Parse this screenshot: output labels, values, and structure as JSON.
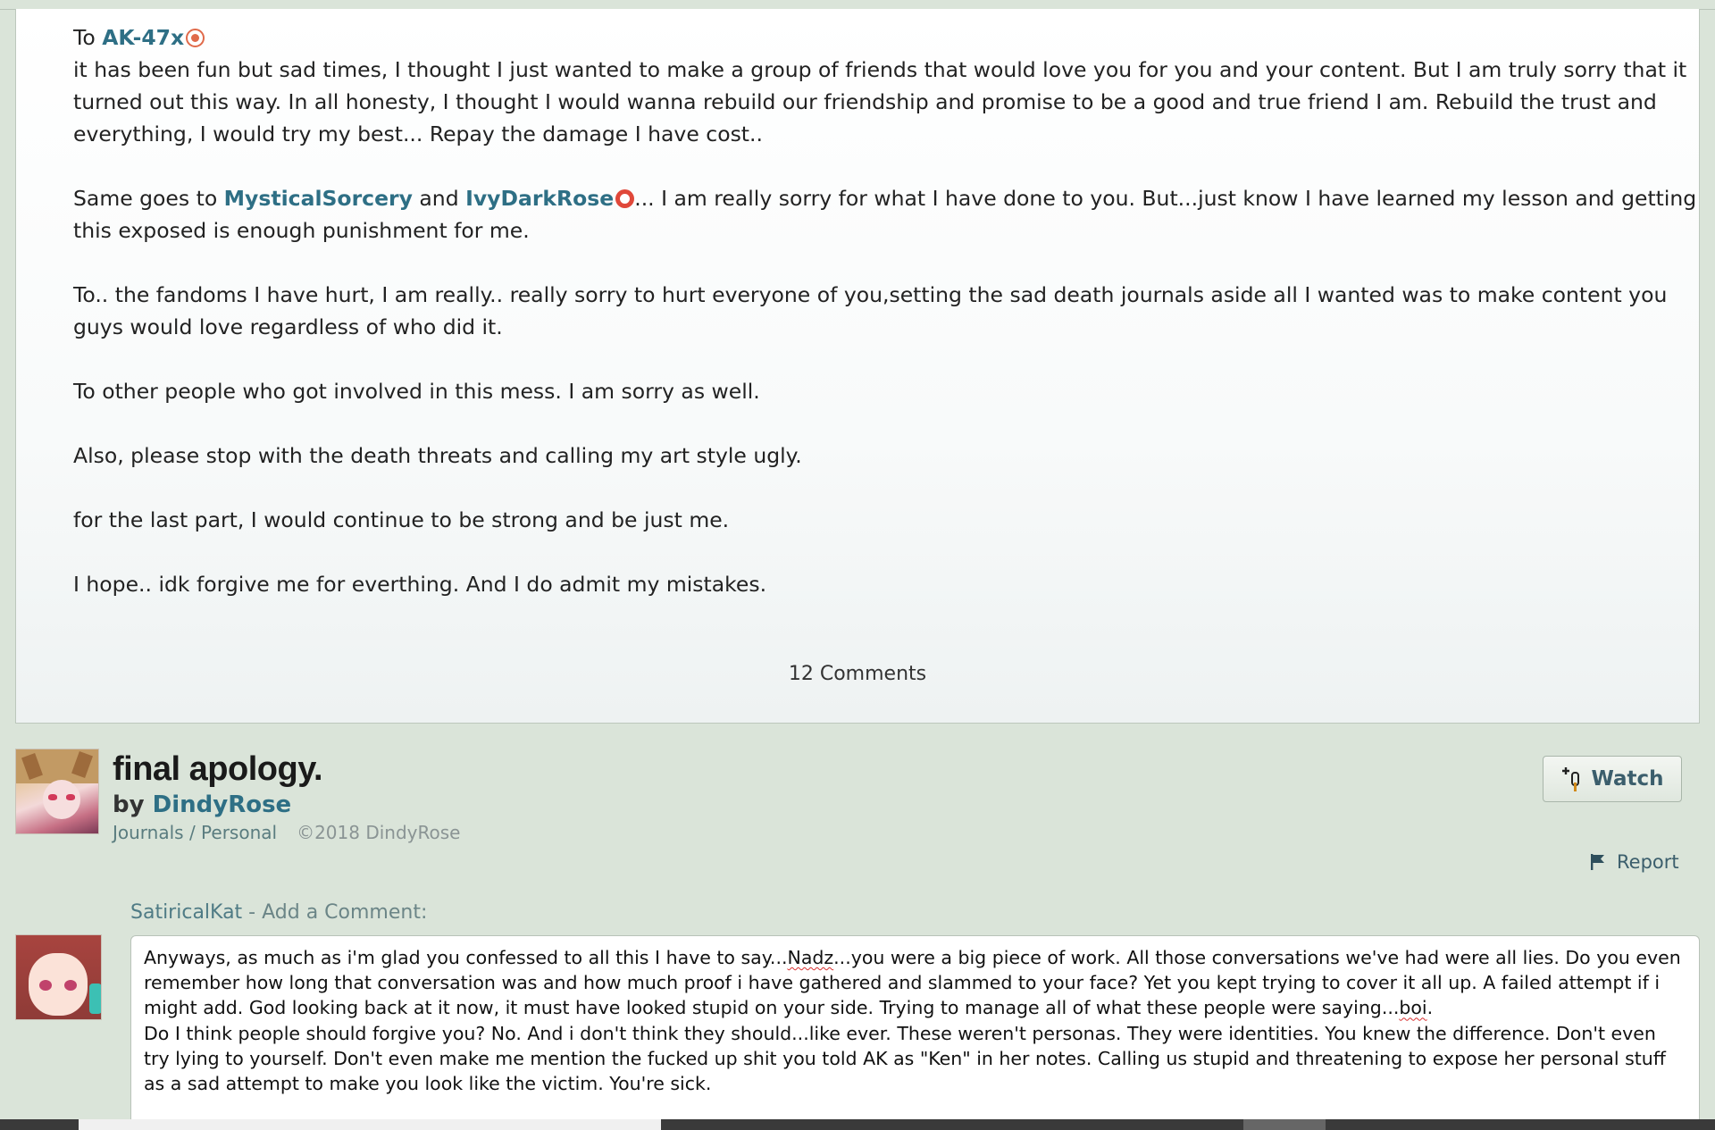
{
  "journal": {
    "to_prefix": "To ",
    "to_user": "AK-47x",
    "para1": "it has been fun but sad times, I thought I just wanted to make a group of friends that would love you for you and your content. But I am truly sorry that it turned out this way. In all honesty, I thought I would wanna rebuild our friendship and promise to be a good and true friend I am. Rebuild the trust and everything, I would try my best... Repay the damage I have cost..",
    "para2_prefix": "Same goes to ",
    "para2_user1": "MysticalSorcery",
    "para2_and": " and ",
    "para2_user2": "IvyDarkRose",
    "para2_rest": "... I am really sorry for what I have done to you. But...just know I have learned my lesson and getting this exposed is enough punishment for me.",
    "para3": "To.. the fandoms I have hurt, I am really.. really sorry to hurt everyone of you,setting the sad death journals aside all I wanted was to make content you guys would love regardless of who did it.",
    "para4": "To other people who got involved in this mess. I am sorry as well.",
    "para5": "Also, please stop with the death threats and calling my art style ugly.",
    "para6": "for the last part, I would continue to be strong and be just me.",
    "para7": "I hope.. idk forgive me for everthing. And I do admit my mistakes.",
    "comments_count": "12 Comments"
  },
  "header": {
    "title": "final apology.",
    "by": "by ",
    "author": "DindyRose",
    "category1": "Journals",
    "category_sep": " / ",
    "category2": "Personal",
    "copyright": "©2018 DindyRose",
    "watch_label": "Watch",
    "report_label": "Report"
  },
  "comment": {
    "user": "SatiricalKat",
    "label_suffix": " - Add a Comment:",
    "line1_a": "Anyways, as much as i'm glad you confessed to all this I have to say...",
    "line1_spell": "Nadz",
    "line1_b": "...you were a big piece of work. All those conversations we've had were all lies. Do you even remember how long that conversation was and how much proof i have gathered and slammed to your face? Yet you kept trying to cover it all up. A failed attempt if i might add. God looking back at it now, it must have looked stupid on your side. Trying to manage all of what these people were saying...",
    "line1_spell2": "boi",
    "line1_c": ".",
    "line2": "Do I think people should forgive you? No. And i don't think they should...like ever. These weren't personas. They were identities. You knew the difference. Don't even try lying to yourself. Don't even make me mention the fucked up shit you told AK as \"Ken\" in her notes. Calling us stupid and threatening to expose her personal stuff as a sad attempt to make you look like the victim. You're sick."
  },
  "icons": {
    "badge1": "star-badge-icon",
    "badge2": "ring-badge-icon",
    "watch": "watch-plus-icon",
    "report": "flag-icon"
  },
  "colors": {
    "background": "#dae4d9",
    "link": "#2e6f85",
    "badge": "#e0483a"
  }
}
